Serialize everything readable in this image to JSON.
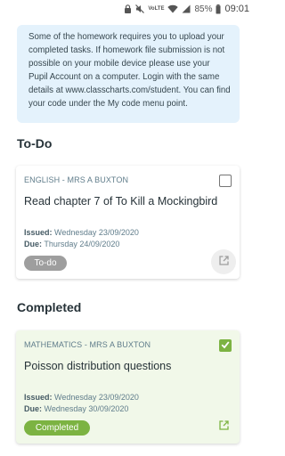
{
  "status_bar": {
    "battery": "85%",
    "time": "09:01",
    "volte": "VoLTE"
  },
  "info": {
    "text": "Some of the homework requires you to upload your completed tasks. If homework file submission is not possible on your mobile device please use your Pupil Account on a computer. Login with the same details at www.classcharts.com/student. You can find your code under the My code menu point."
  },
  "sections": {
    "todo_title": "To-Do",
    "completed_title": "Completed"
  },
  "todo_card": {
    "subject": "ENGLISH - MRS A BUXTON",
    "title": "Read chapter 7 of To Kill a Mockingbird",
    "issued_label": "Issued:",
    "issued_value": "Wednesday 23/09/2020",
    "due_label": "Due:",
    "due_value": "Thursday 24/09/2020",
    "status": "To-do",
    "checked": false
  },
  "completed_card": {
    "subject": "MATHEMATICS - MRS A BUXTON",
    "title": "Poisson distribution questions",
    "issued_label": "Issued:",
    "issued_value": "Wednesday 23/09/2020",
    "due_label": "Due:",
    "due_value": "Wednesday 30/09/2020",
    "status": "Completed",
    "checked": true
  },
  "colors": {
    "accent_green": "#7cb342",
    "info_background": "#e4f2fc",
    "todo_pill": "#9e9e9e",
    "completed_card_bg": "#f1f8e9"
  },
  "icons": {
    "open_external": "open-in-new-icon",
    "check": "check-icon"
  }
}
